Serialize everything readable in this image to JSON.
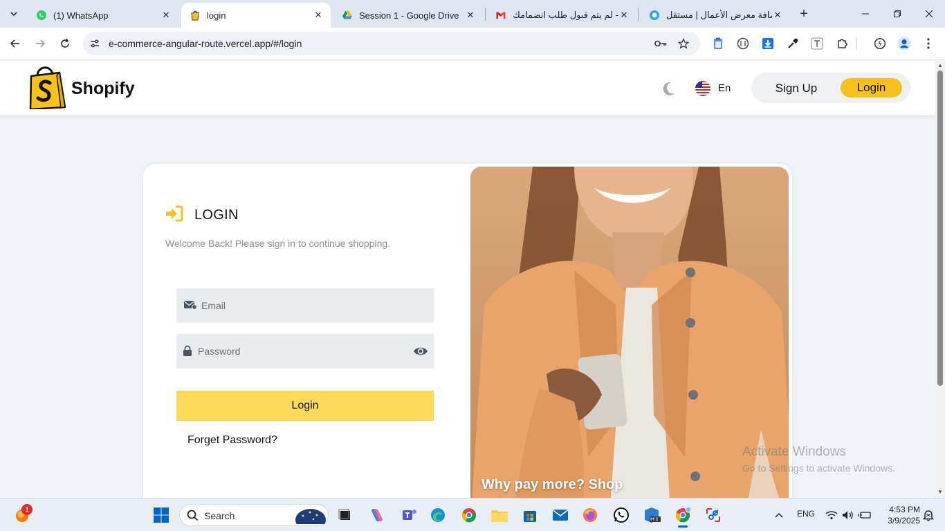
{
  "browser": {
    "tabs": [
      {
        "title": "(1) WhatsApp",
        "icon": "whatsapp-icon"
      },
      {
        "title": "login",
        "icon": "shopify-bag-icon",
        "active": true
      },
      {
        "title": "Session 1 - Google Drive",
        "icon": "google-drive-icon"
      },
      {
        "title": "لم يتم قبول طلب انضمامك -",
        "icon": "gmail-icon"
      },
      {
        "title": "إضافة معرض الأعمال | مستقل",
        "icon": "mostaql-icon"
      }
    ],
    "url": "e-commerce-angular-route.vercel.app/#/login"
  },
  "header": {
    "brand": "Shopify",
    "language": "En",
    "signup_label": "Sign Up",
    "login_label": "Login"
  },
  "login": {
    "title": "LOGIN",
    "subtitle": "Welcome Back! Please sign in to continue shopping.",
    "email_placeholder": "Email",
    "password_placeholder": "Password",
    "submit_label": "Login",
    "forget_label": "Forget Password?",
    "image_caption": "Why pay more? Shop"
  },
  "watermark": {
    "line1": "Activate Windows",
    "line2": "Go to Settings to activate Windows."
  },
  "taskbar": {
    "search_label": "Search",
    "notification_count": "1",
    "language": "ENG",
    "time": "4:53 PM",
    "date": "3/9/2025"
  },
  "colors": {
    "accent": "#f8c21c",
    "login_button": "#ffd95a"
  }
}
